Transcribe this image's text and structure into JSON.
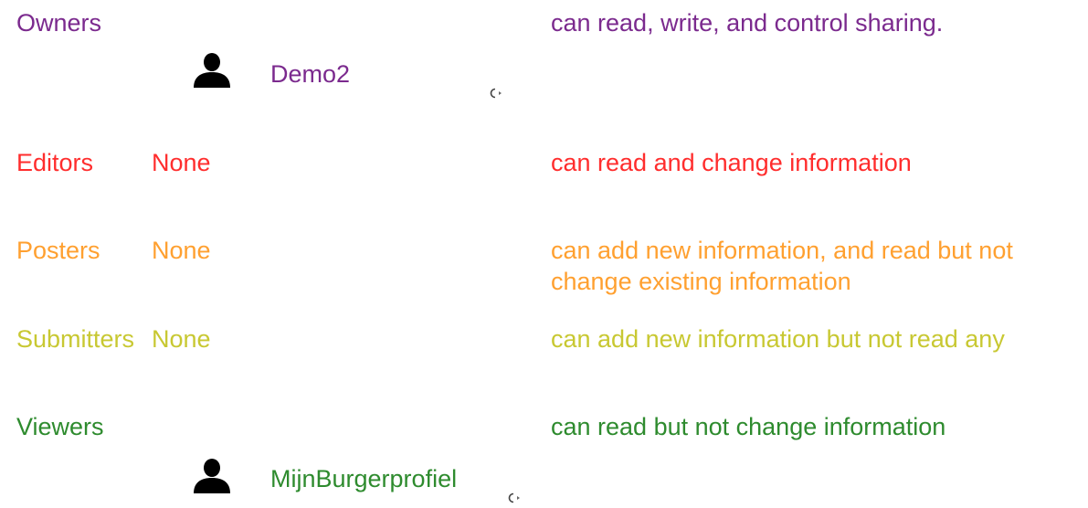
{
  "colors": {
    "owners": "#7b2a8e",
    "editors": "#ff2d2d",
    "posters": "#ffa030",
    "submitters": "#c8c832",
    "viewers": "#2e8b2e"
  },
  "roles": {
    "owners": {
      "label": "Owners",
      "value": "",
      "description": "can read, write, and control sharing.",
      "member": "Demo2",
      "member_icon": "person-icon",
      "remove_icon": "remove-member-icon"
    },
    "editors": {
      "label": "Editors",
      "value": "None",
      "description": "can read and change information"
    },
    "posters": {
      "label": "Posters",
      "value": "None",
      "description": "can add new information, and read but not change existing information"
    },
    "submitters": {
      "label": "Submitters",
      "value": "None",
      "description": "can add new information but not read any"
    },
    "viewers": {
      "label": "Viewers",
      "value": "",
      "description": "can read but not change information",
      "member": "MijnBurgerprofiel",
      "member_icon": "person-icon",
      "remove_icon": "remove-member-icon"
    }
  }
}
